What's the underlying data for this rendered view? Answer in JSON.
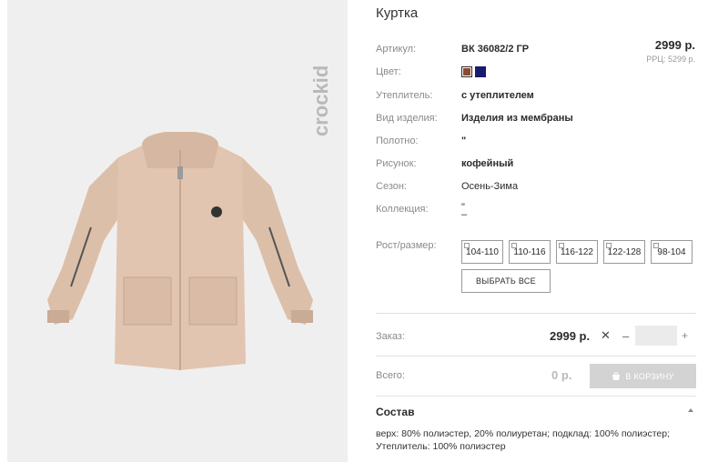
{
  "product": {
    "title": "Куртка",
    "brand_logo_alt": "crockid"
  },
  "attributes": {
    "article_label": "Артикул:",
    "article_value": "ВК 36082/2 ГР",
    "color_label": "Цвет:",
    "insulation_label": "Утеплитель:",
    "insulation_value": "с утеплителем",
    "type_label": "Вид изделия:",
    "type_value": "Изделия из мембраны",
    "fabric_label": "Полотно:",
    "fabric_value": "\"",
    "pattern_label": "Рисунок:",
    "pattern_value": "кофейный",
    "season_label": "Сезон:",
    "season_value": "Осень-Зима",
    "collection_label": "Коллекция:",
    "collection_value": "\"",
    "collection_value2": "–",
    "size_label": "Рост/размер:"
  },
  "pricing": {
    "price": "2999 р.",
    "rrp": "РРЦ: 5299 р."
  },
  "colors": [
    "#8b4a32",
    "#1a1a6e"
  ],
  "sizes": [
    "104-110",
    "110-116",
    "116-122",
    "122-128",
    "98-104"
  ],
  "select_all_label": "ВЫБРАТЬ ВСЕ",
  "order": {
    "label": "Заказ:",
    "price": "2999 р.",
    "times": "✕",
    "minus": "–",
    "plus": "+",
    "quantity": ""
  },
  "total": {
    "label": "Всего:",
    "value": "0 р.",
    "cart_button": "В КОРЗИНУ"
  },
  "composition": {
    "title": "Состав",
    "toggle_icon": "chevron-up",
    "line1": "верх: 80% полиэстер, 20% полиуретан; подклад: 100% полиэстер;",
    "line2": "Утеплитель: 100% полиэстер"
  }
}
